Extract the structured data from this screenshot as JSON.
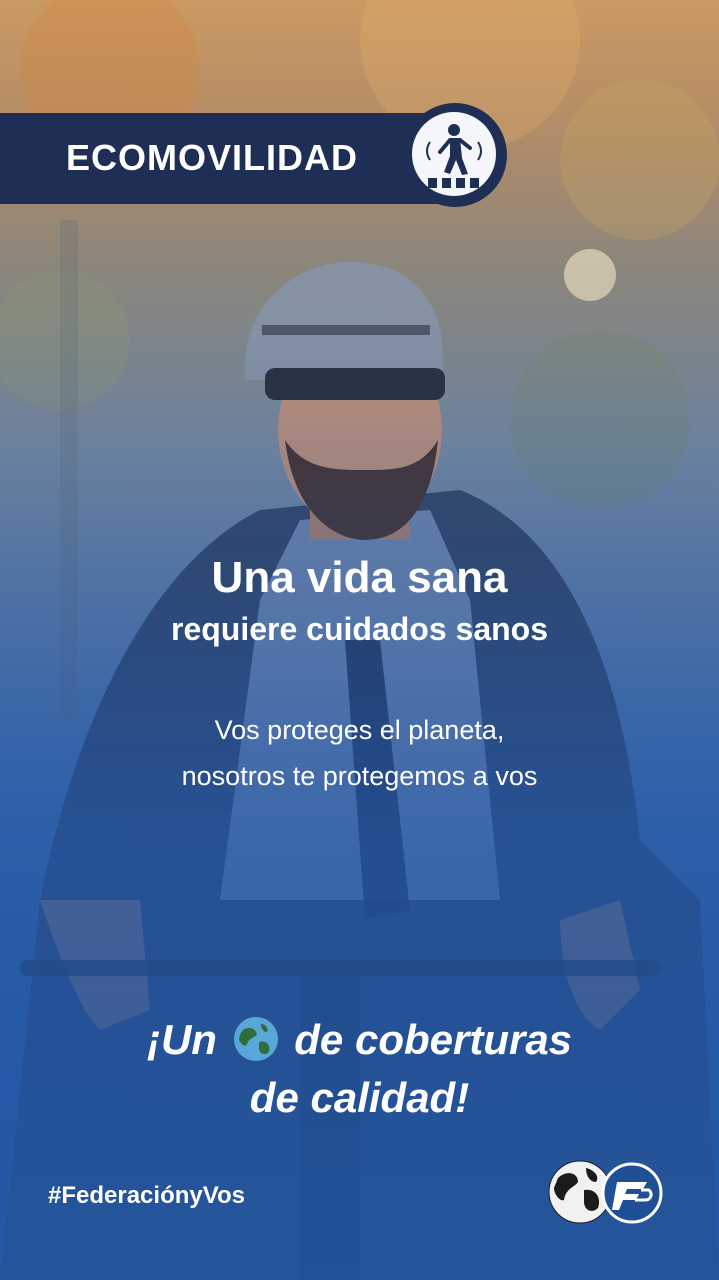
{
  "banner": {
    "label": "ECOMOVILIDAD",
    "icon": "pedestrian-crossing-icon"
  },
  "headline": {
    "line1": "Una vida sana",
    "line2": "requiere cuidados sanos"
  },
  "subtext": {
    "line1": "Vos proteges el planeta,",
    "line2": "nosotros te protegemos a vos"
  },
  "slogan": {
    "before_icon": "¡Un",
    "icon": "globe-icon",
    "after_icon": "de coberturas",
    "line2": "de calidad!"
  },
  "footer": {
    "hashtag": "#FederaciónyVos",
    "logo_icons": [
      "globe-logo-icon",
      "fp-logo-icon"
    ]
  },
  "colors": {
    "banner": "#1f2e55",
    "text": "#ffffff",
    "background_blue": "#2357a0"
  }
}
